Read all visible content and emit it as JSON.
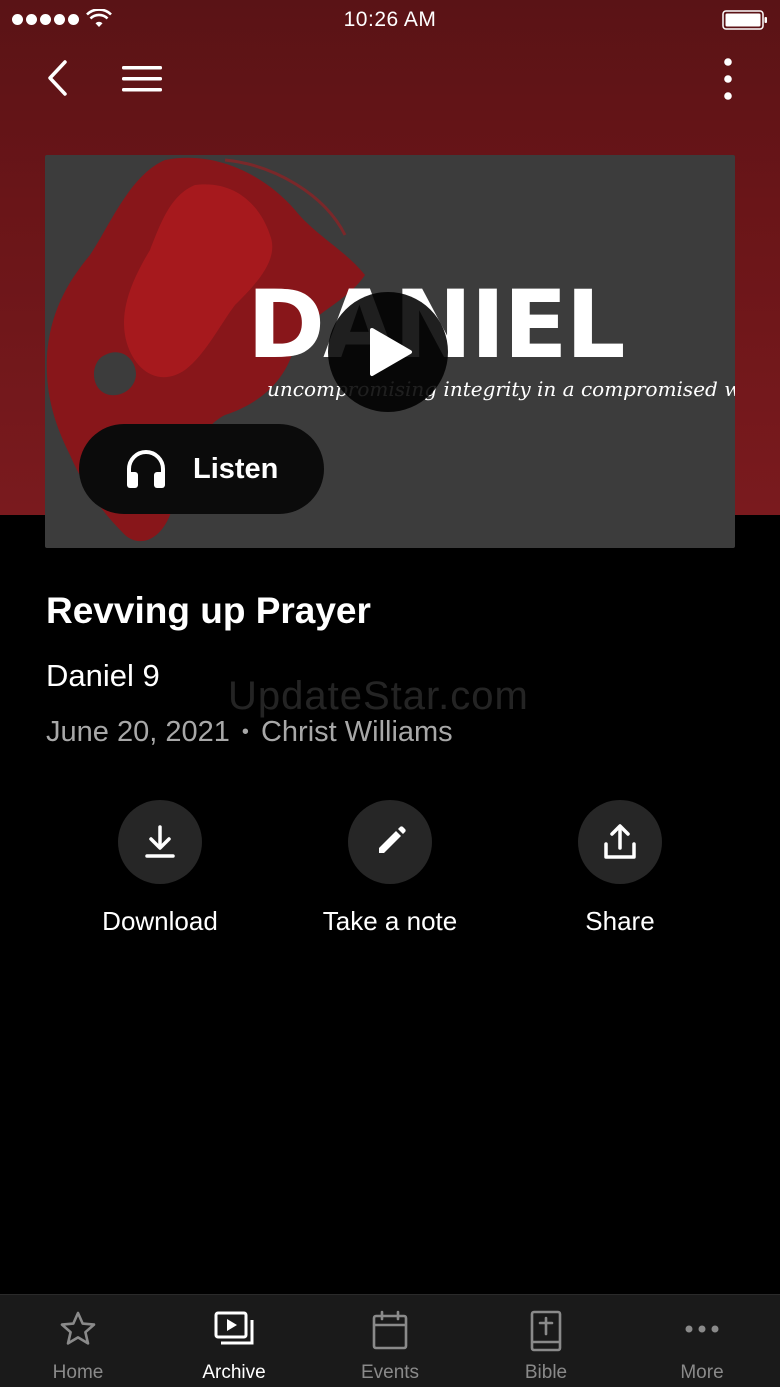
{
  "status_bar": {
    "time": "10:26 AM"
  },
  "artwork": {
    "title": "DANIEL",
    "subtitle": "uncompromising integrity in a compromised world"
  },
  "listen_button": {
    "label": "Listen"
  },
  "sermon": {
    "title": "Revving up Prayer",
    "passage": "Daniel 9",
    "date": "June 20, 2021",
    "separator": "•",
    "speaker": "Christ Williams"
  },
  "watermark": "UpdateStar.com",
  "actions": [
    {
      "label": "Download",
      "icon": "download-icon"
    },
    {
      "label": "Take a note",
      "icon": "pencil-icon"
    },
    {
      "label": "Share",
      "icon": "share-icon"
    }
  ],
  "tabs": [
    {
      "label": "Home",
      "icon": "star-icon",
      "active": false
    },
    {
      "label": "Archive",
      "icon": "archive-icon",
      "active": true
    },
    {
      "label": "Events",
      "icon": "calendar-icon",
      "active": false
    },
    {
      "label": "Bible",
      "icon": "bible-icon",
      "active": false
    },
    {
      "label": "More",
      "icon": "more-dots-icon",
      "active": false
    }
  ],
  "colors": {
    "hero_red": "#6a1518",
    "background": "#000000",
    "tab_bar": "#1a1a1a",
    "inactive_tab": "#8a8a8a"
  }
}
